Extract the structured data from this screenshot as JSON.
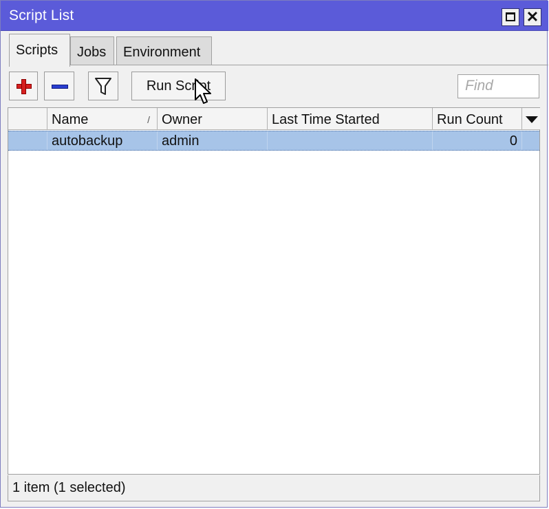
{
  "window": {
    "title": "Script List"
  },
  "titlebar_buttons": {
    "maximize_icon": "maximize-icon",
    "close_label": "✕"
  },
  "tabs": [
    {
      "label": "Scripts",
      "active": true
    },
    {
      "label": "Jobs",
      "active": false
    },
    {
      "label": "Environment",
      "active": false
    }
  ],
  "toolbar": {
    "add_icon": "plus-icon",
    "remove_icon": "minus-icon",
    "filter_icon": "filter-icon",
    "run_label": "Run Script",
    "find_placeholder": "Find"
  },
  "table": {
    "columns": [
      "Name",
      "Owner",
      "Last Time Started",
      "Run Count"
    ],
    "sort_indicator": "/",
    "rows": [
      {
        "name": "autobackup",
        "owner": "admin",
        "last_time_started": "",
        "run_count": "0",
        "selected": true
      }
    ]
  },
  "status": {
    "text": "1 item (1 selected)"
  },
  "colors": {
    "titlebar": "#5b5bd9",
    "selection": "#a7c4e8",
    "add": "#d62020",
    "remove": "#2a3fd0"
  }
}
